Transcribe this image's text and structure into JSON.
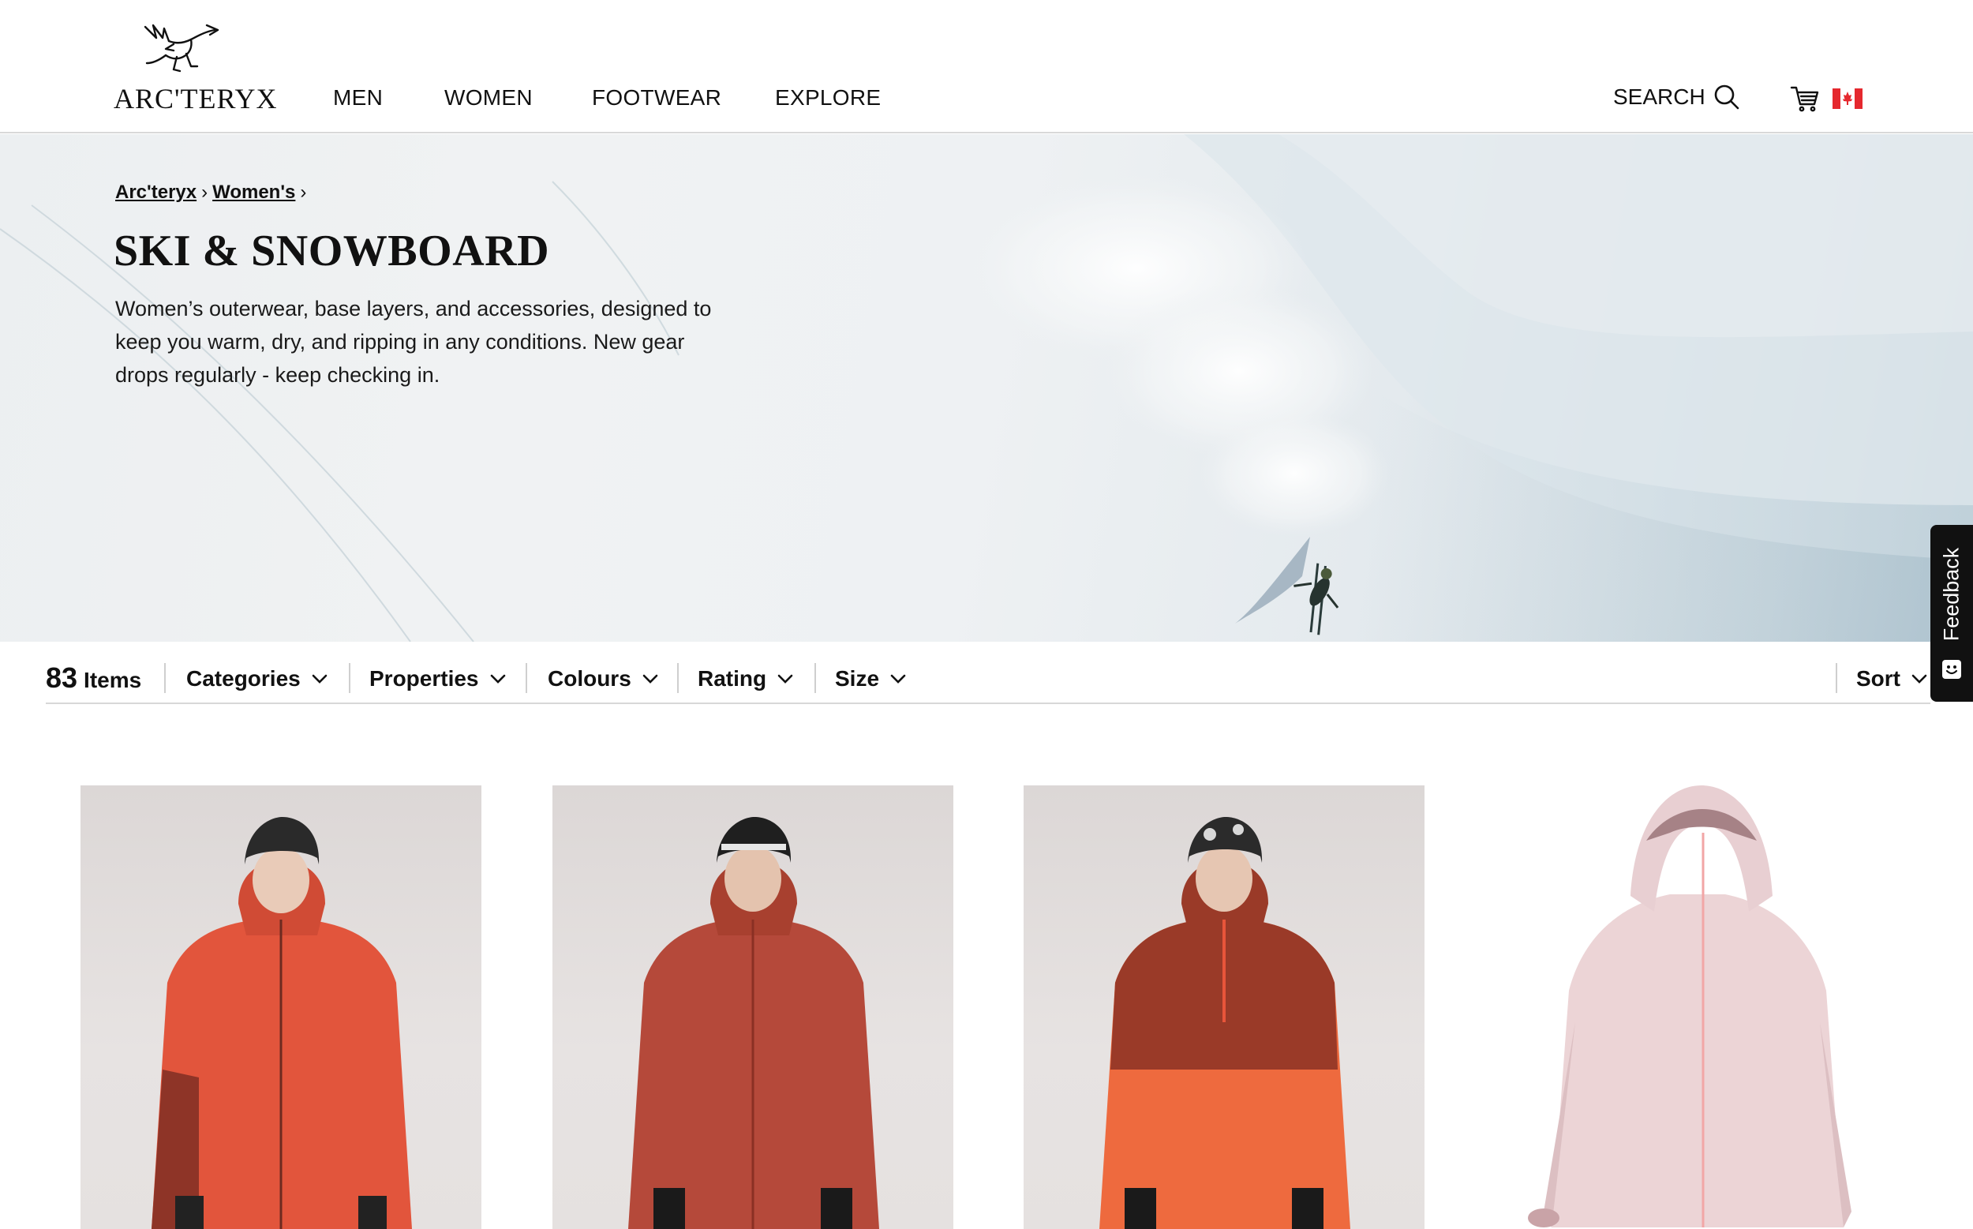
{
  "header": {
    "logo_text": "ARC'TERYX",
    "nav": [
      {
        "label": "MEN"
      },
      {
        "label": "WOMEN"
      },
      {
        "label": "FOOTWEAR"
      },
      {
        "label": "EXPLORE"
      }
    ],
    "search_label": "SEARCH",
    "cart_icon": "cart-icon",
    "country_flag": "canada-flag-icon"
  },
  "hero": {
    "breadcrumb": [
      {
        "label": "Arc'teryx"
      },
      {
        "label": "Women's"
      }
    ],
    "title": "SKI & SNOWBOARD",
    "description": "Women’s outerwear, base layers, and accessories, designed to keep you warm, dry, and ripping in any conditions. New gear drops regularly - keep checking in."
  },
  "feedback": {
    "label": "Feedback"
  },
  "filters": {
    "count": "83",
    "count_label": "Items",
    "items": [
      {
        "label": "Categories"
      },
      {
        "label": "Properties"
      },
      {
        "label": "Colours"
      },
      {
        "label": "Rating"
      },
      {
        "label": "Size"
      }
    ],
    "sort_label": "Sort"
  },
  "products": [
    {
      "image": "model wearing orange ski jacket with black beanie",
      "jacket_color": "#e2553c",
      "accent_color": "#8e3427"
    },
    {
      "image": "model wearing rust red ski jacket with patterned beanie",
      "jacket_color": "#b5493a",
      "accent_color": "#8a3024"
    },
    {
      "image": "model wearing two-tone orange anorak with camo beanie",
      "jacket_color": "#ee6a3e",
      "accent_color": "#9a3a28"
    },
    {
      "image": "pale pink ski jacket product shot",
      "jacket_color": "#ecd4d6",
      "accent_color": "#e28a8c"
    }
  ]
}
